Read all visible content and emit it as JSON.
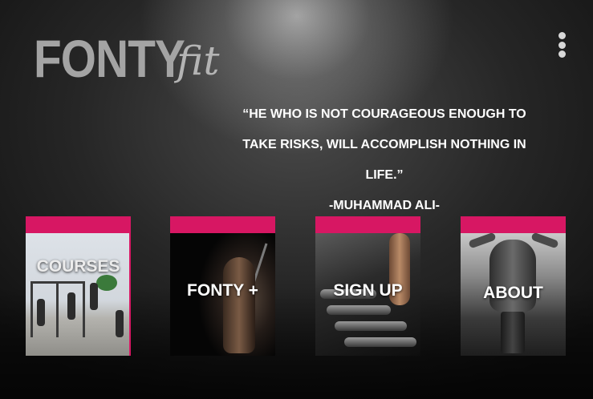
{
  "logo": {
    "main": "FONTY",
    "script": "fit"
  },
  "menu": {
    "icon": "kebab-menu-icon"
  },
  "quote": {
    "text": "“He who is not courageous enough to take risks, will accomplish nothing in life.”",
    "author": "-Muhammad Ali-"
  },
  "cards": [
    {
      "label": "Courses"
    },
    {
      "label": "Fonty +"
    },
    {
      "label": "Sign Up"
    },
    {
      "label": "About"
    }
  ],
  "colors": {
    "accent": "#d71763",
    "logo": "#a4a4a4",
    "text": "#ffffff"
  }
}
